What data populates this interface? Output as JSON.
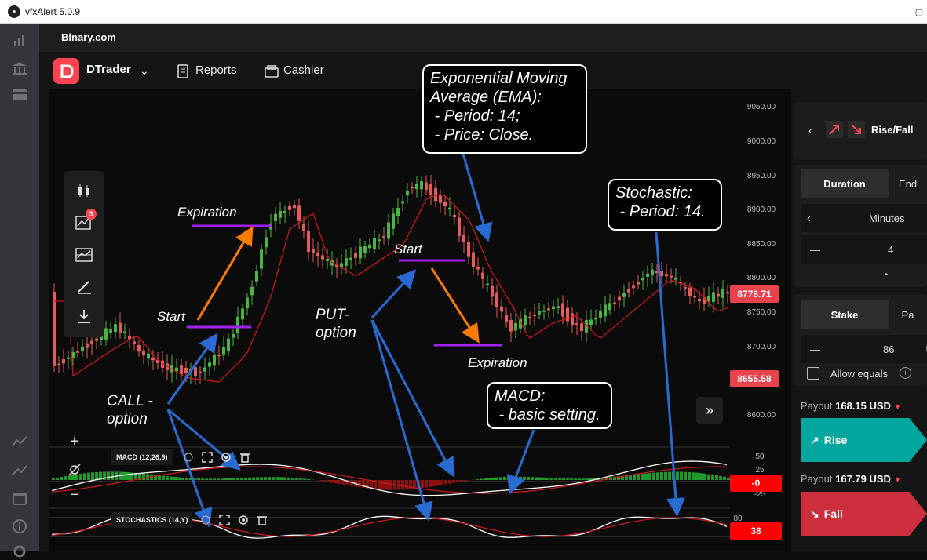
{
  "window": {
    "title": "vfxAlert 5.0.9"
  },
  "browser": {
    "site": "Binary.com"
  },
  "nav": {
    "brand": "DTrader",
    "reports": "Reports",
    "cashier": "Cashier"
  },
  "chart": {
    "price_axis": [
      "9050.00",
      "9000.00",
      "8950.00",
      "8900.00",
      "8850.00",
      "8800.00",
      "8750.00",
      "8700.00",
      "8600.00"
    ],
    "current_price": "8778.71",
    "barrier_price": "8655.58",
    "toolbar_badge": "3",
    "macd": {
      "label": "MACD (12,26,9)",
      "scale": [
        "50",
        "25",
        "-25"
      ],
      "value": "-0"
    },
    "stochastics": {
      "label": "STOCHASTICS (14,Y)",
      "scale": [
        "80"
      ],
      "value": "38"
    }
  },
  "annotations": {
    "ema_note": "Exponential Moving\nAverage (EMA):\n - Period: 14;\n - Price: Close.",
    "stochastic_note": "Stochastic:\n - Period: 14.",
    "macd_note": "MACD:\n - basic setting.",
    "call_option": "CALL -\noption",
    "put_option": "PUT-\noption",
    "start_1": "Start",
    "start_2": "Start",
    "expiration_1": "Expiration",
    "expiration_2": "Expiration"
  },
  "trade": {
    "contract_type": "Rise/Fall",
    "duration_tab": "Duration",
    "end_tab": "End",
    "duration_unit": "Minutes",
    "duration_value": "4",
    "stake_tab": "Stake",
    "payout_tab": "Pa",
    "stake_value": "86",
    "stake_currency": "U",
    "allow_equals": "Allow equals",
    "rise_payout_label": "Payout",
    "rise_payout": "168.15 USD",
    "rise_button": "Rise",
    "fall_payout_label": "Payout",
    "fall_payout": "167.79 USD",
    "fall_button": "Fall"
  },
  "colors": {
    "accent": "#ff444f",
    "rise": "#00a79e",
    "fall": "#cc2e3d",
    "up_candle": "#4bb543",
    "down_candle": "#e35b5b",
    "annotation_line": "#a020f0"
  }
}
